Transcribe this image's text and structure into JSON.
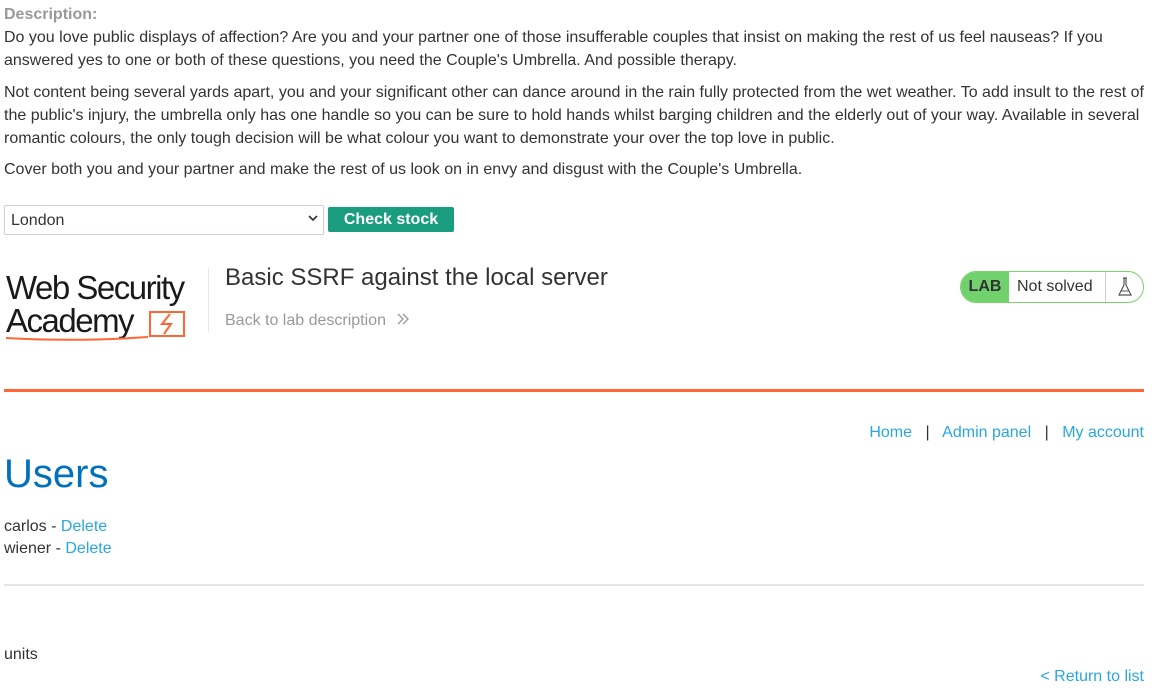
{
  "description": {
    "label": "Description:",
    "paragraphs": [
      "Do you love public displays of affection? Are you and your partner one of those insufferable couples that insist on making the rest of us feel nauseas? If you answered yes to one or both of these questions, you need the Couple's Umbrella. And possible therapy.",
      "Not content being several yards apart, you and your significant other can dance around in the rain fully protected from the wet weather. To add insult to the rest of the public's injury, the umbrella only has one handle so you can be sure to hold hands whilst barging children and the elderly out of your way. Available in several romantic colours, the only tough decision will be what colour you want to demonstrate your over the top love in public.",
      "Cover both you and your partner and make the rest of us look on in envy and disgust with the Couple's Umbrella."
    ]
  },
  "stock_check": {
    "selected_store": "London",
    "button_label": "Check stock"
  },
  "lab_header": {
    "logo_text_line1": "Web Security",
    "logo_text_line2": "Academy",
    "title": "Basic SSRF against the local server",
    "back_link": "Back to lab description",
    "status_tag": "LAB",
    "status_text": "Not solved",
    "colors": {
      "accent_orange": "#ff6633",
      "lab_green": "#70d16d",
      "link_blue": "#29a7de",
      "heading_blue": "#0071bc"
    }
  },
  "nav": {
    "home": "Home",
    "admin_panel": "Admin panel",
    "my_account": "My account",
    "separator": "|"
  },
  "users_page": {
    "heading": "Users",
    "users": [
      {
        "name": "carlos",
        "dash": "-",
        "action": "Delete"
      },
      {
        "name": "wiener",
        "dash": "-",
        "action": "Delete"
      }
    ]
  },
  "footer": {
    "units_label": "units",
    "return_link": "< Return to list"
  }
}
